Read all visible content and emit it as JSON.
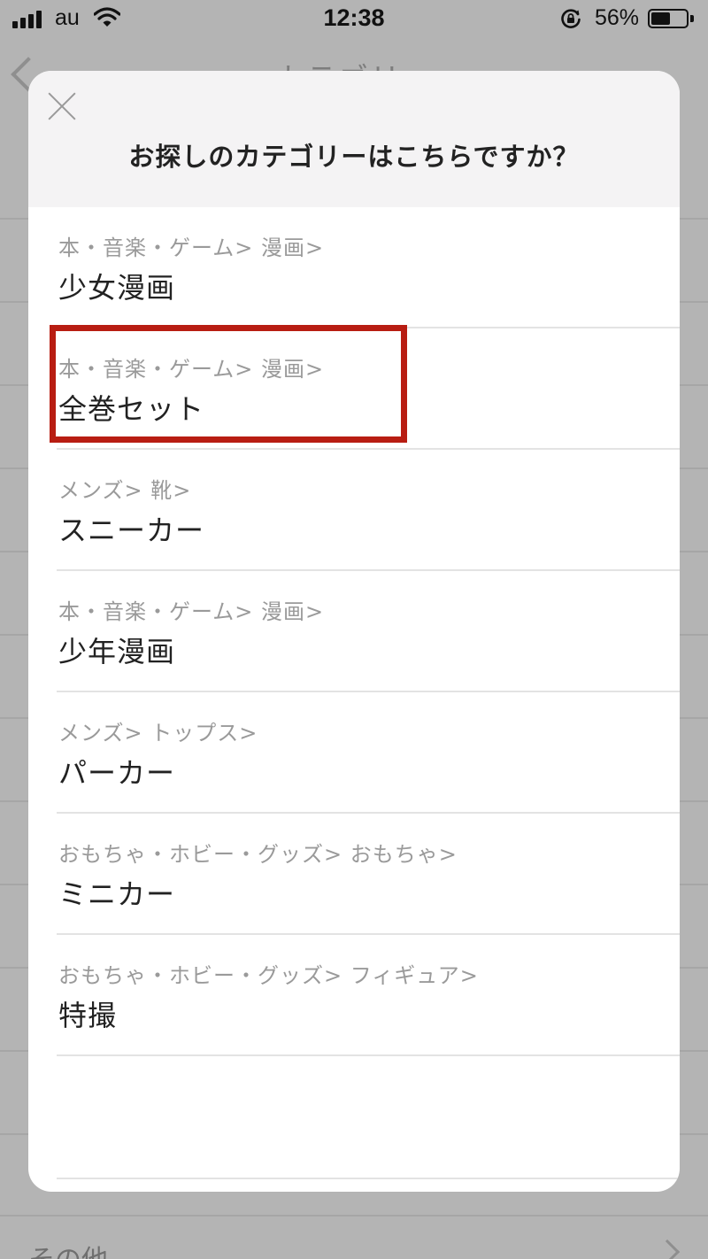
{
  "status_bar": {
    "carrier": "au",
    "time": "12:38",
    "battery_percent": "56%",
    "battery_level": 0.56,
    "icons": [
      "signal-icon",
      "wifi-icon",
      "rotation-lock-icon",
      "battery-icon"
    ]
  },
  "background": {
    "nav_title": "カテゴリー",
    "last_row_label": "その他"
  },
  "modal": {
    "title": "お探しのカテゴリーはこちらですか？",
    "close_icon": "close-icon",
    "items": [
      {
        "path": "本・音楽・ゲーム> 漫画>",
        "name": "少女漫画"
      },
      {
        "path": "本・音楽・ゲーム> 漫画>",
        "name": "全巻セット"
      },
      {
        "path": "メンズ> 靴>",
        "name": "スニーカー"
      },
      {
        "path": "本・音楽・ゲーム> 漫画>",
        "name": "少年漫画"
      },
      {
        "path": "メンズ> トップス>",
        "name": "パーカー"
      },
      {
        "path": "おもちゃ・ホビー・グッズ> おもちゃ>",
        "name": "ミニカー"
      },
      {
        "path": "おもちゃ・ホビー・グッズ> フィギュア>",
        "name": "特撮"
      }
    ],
    "highlighted_item_index": 1
  },
  "colors": {
    "highlight": "#b81d12",
    "overlay": "#b4b4b4",
    "header_bg": "#f4f3f4"
  }
}
